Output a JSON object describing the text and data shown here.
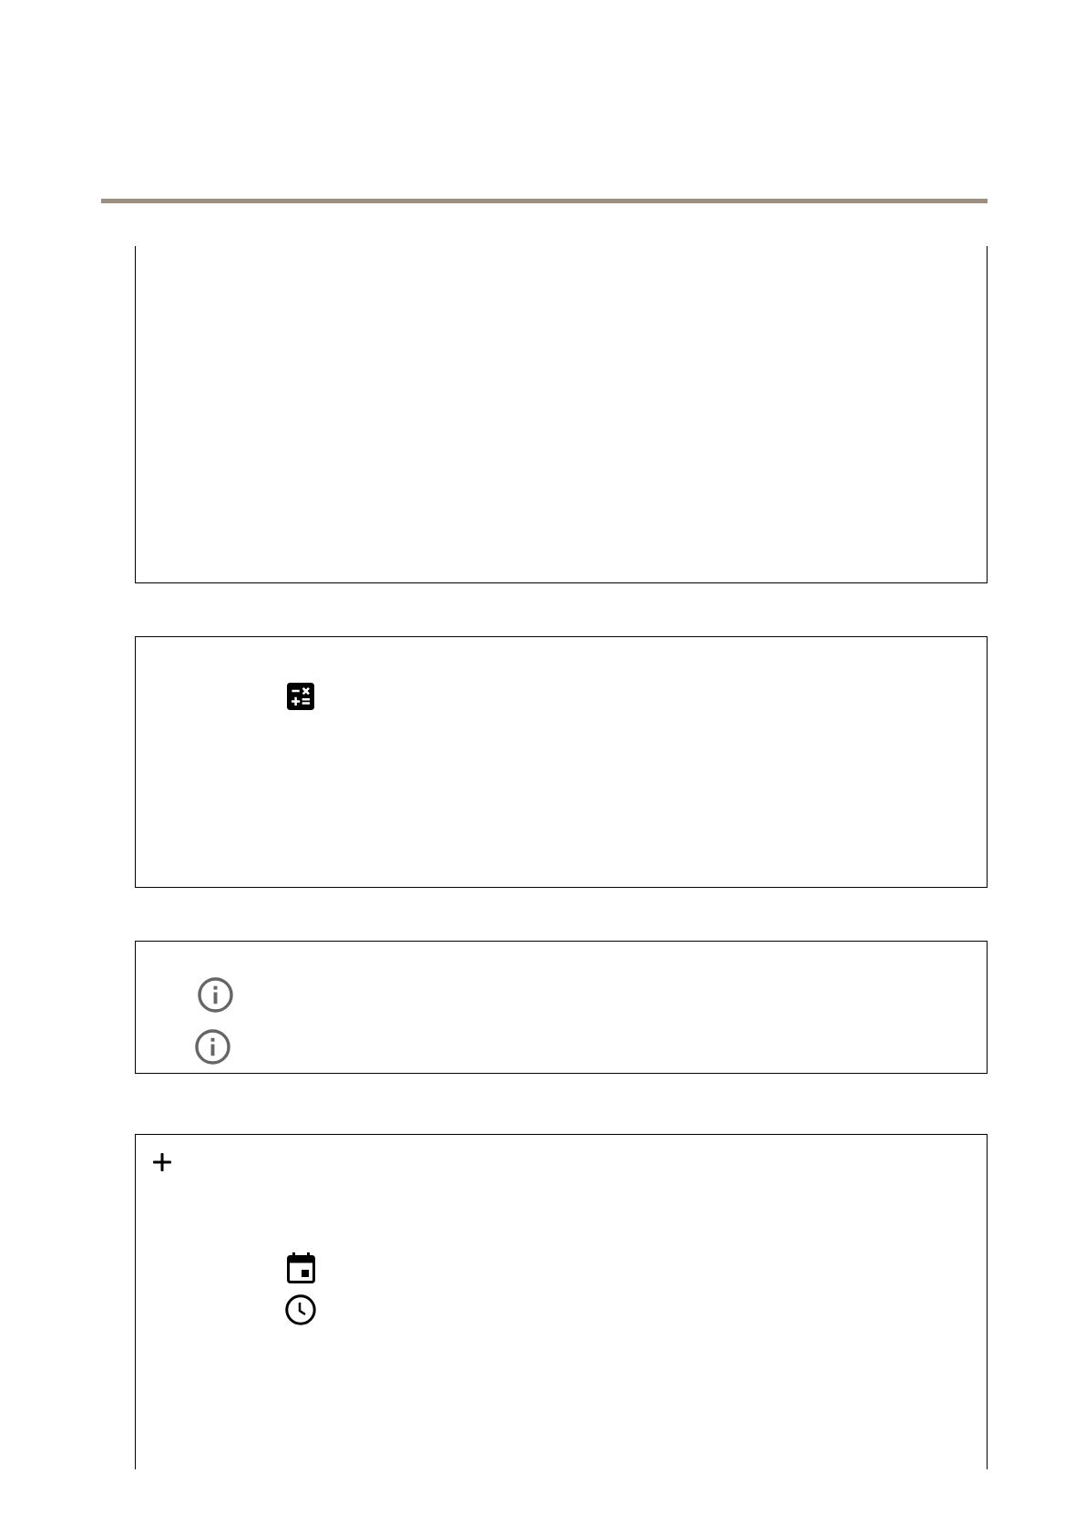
{
  "panels": [
    {
      "kind": "continued_top"
    },
    {
      "kind": "closed"
    },
    {
      "kind": "closed"
    },
    {
      "kind": "continued_bottom"
    }
  ]
}
